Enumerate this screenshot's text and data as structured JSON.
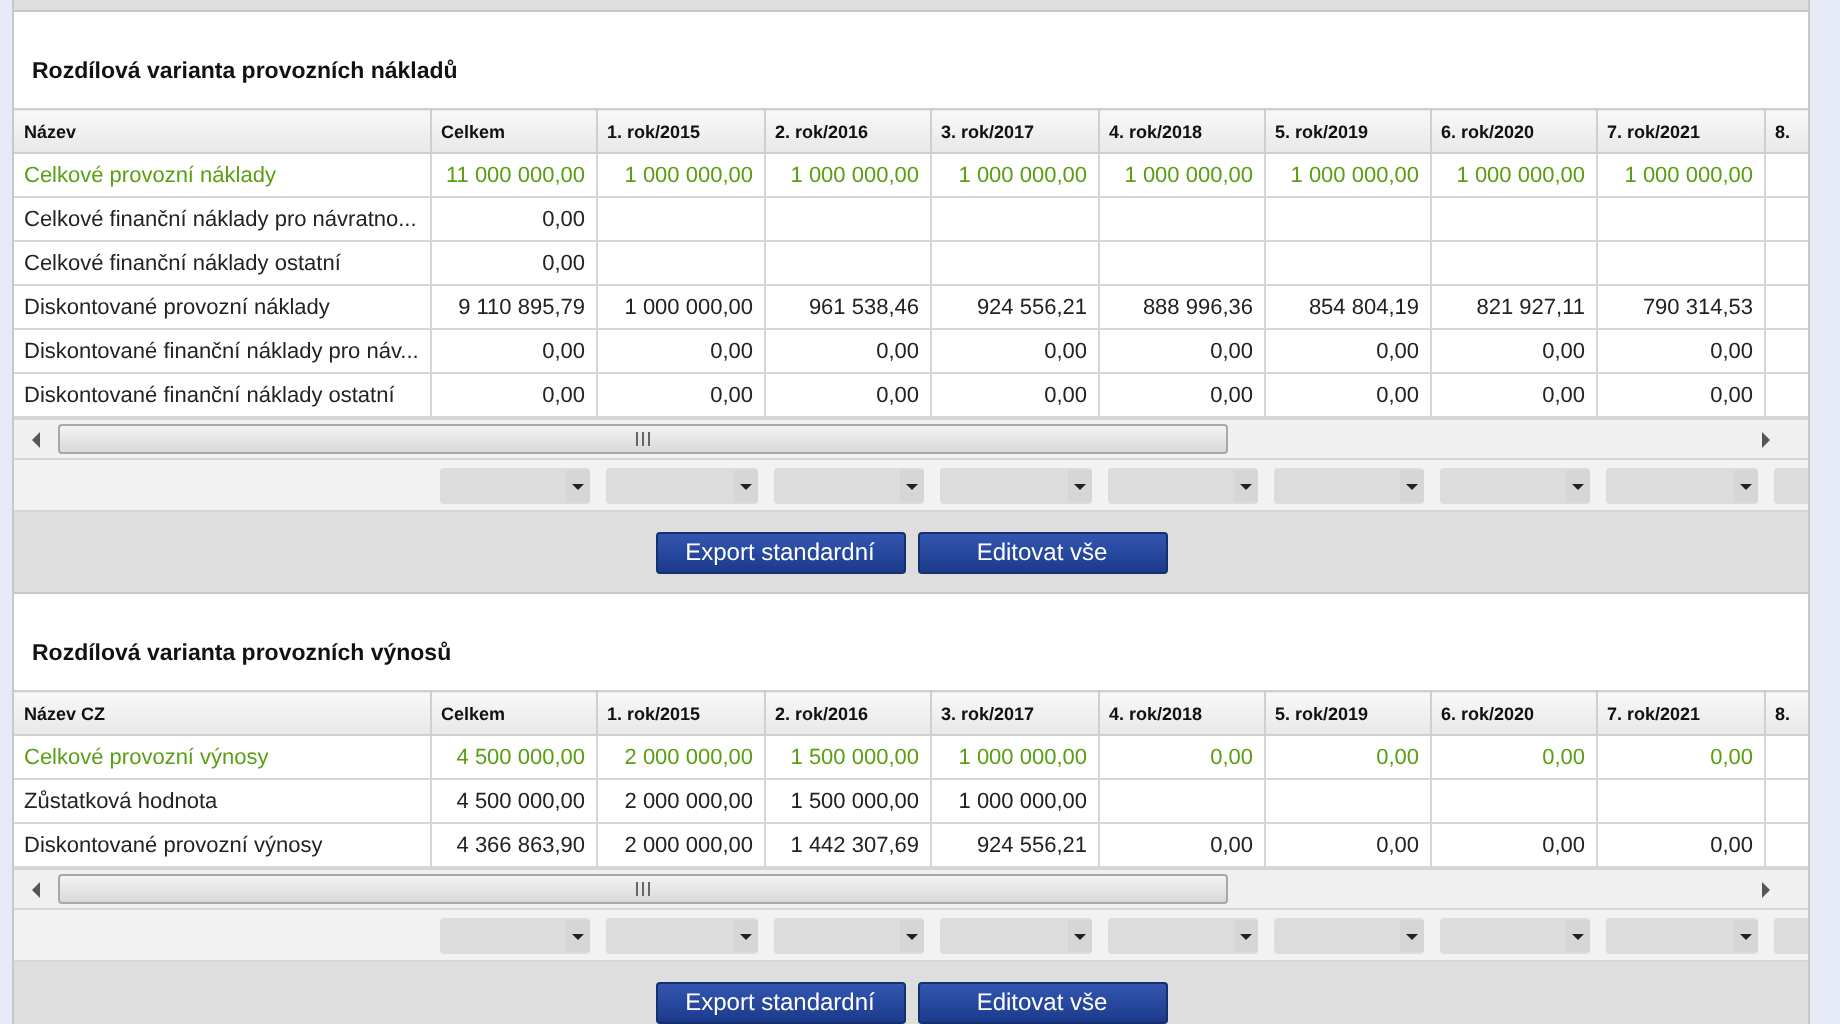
{
  "sections": [
    {
      "title": "Rozdílová varianta provozních nákladů",
      "columns": [
        "Název",
        "Celkem",
        "1. rok/2015",
        "2. rok/2016",
        "3. rok/2017",
        "4. rok/2018",
        "5. rok/2019",
        "6. rok/2020",
        "7. rok/2021",
        "8."
      ],
      "rows": [
        {
          "kind": "total",
          "cells": [
            "Celkové provozní náklady",
            "11 000 000,00",
            "1 000 000,00",
            "1 000 000,00",
            "1 000 000,00",
            "1 000 000,00",
            "1 000 000,00",
            "1 000 000,00",
            "1 000 000,00"
          ]
        },
        {
          "kind": "plain",
          "cells": [
            "Celkové finanční náklady pro návratno...",
            "0,00"
          ]
        },
        {
          "kind": "plain",
          "cells": [
            "Celkové finanční náklady ostatní",
            "0,00"
          ]
        },
        {
          "kind": "plain",
          "cells": [
            "Diskontované provozní náklady",
            "9 110 895,79",
            "1 000 000,00",
            "961 538,46",
            "924 556,21",
            "888 996,36",
            "854 804,19",
            "821 927,11",
            "790 314,53"
          ]
        },
        {
          "kind": "plain",
          "cells": [
            "Diskontované finanční náklady pro náv...",
            "0,00",
            "0,00",
            "0,00",
            "0,00",
            "0,00",
            "0,00",
            "0,00",
            "0,00"
          ]
        },
        {
          "kind": "plain",
          "cells": [
            "Diskontované finanční náklady ostatní",
            "0,00",
            "0,00",
            "0,00",
            "0,00",
            "0,00",
            "0,00",
            "0,00",
            "0,00"
          ]
        }
      ],
      "buttons": [
        "Export standardní",
        "Editovat vše"
      ]
    },
    {
      "title": "Rozdílová varianta provozních výnosů",
      "columns": [
        "Název CZ",
        "Celkem",
        "1. rok/2015",
        "2. rok/2016",
        "3. rok/2017",
        "4. rok/2018",
        "5. rok/2019",
        "6. rok/2020",
        "7. rok/2021",
        "8."
      ],
      "rows": [
        {
          "kind": "total",
          "cells": [
            "Celkové provozní výnosy",
            "4 500 000,00",
            "2 000 000,00",
            "1 500 000,00",
            "1 000 000,00",
            "0,00",
            "0,00",
            "0,00",
            "0,00"
          ]
        },
        {
          "kind": "plain",
          "cells": [
            "Zůstatková hodnota",
            "4 500 000,00",
            "2 000 000,00",
            "1 500 000,00",
            "1 000 000,00"
          ]
        },
        {
          "kind": "plain",
          "cells": [
            "Diskontované provozní výnosy",
            "4 366 863,90",
            "2 000 000,00",
            "1 442 307,69",
            "924 556,21",
            "0,00",
            "0,00",
            "0,00",
            "0,00"
          ]
        }
      ],
      "buttons": [
        "Export standardní",
        "Editovat vše"
      ]
    }
  ]
}
